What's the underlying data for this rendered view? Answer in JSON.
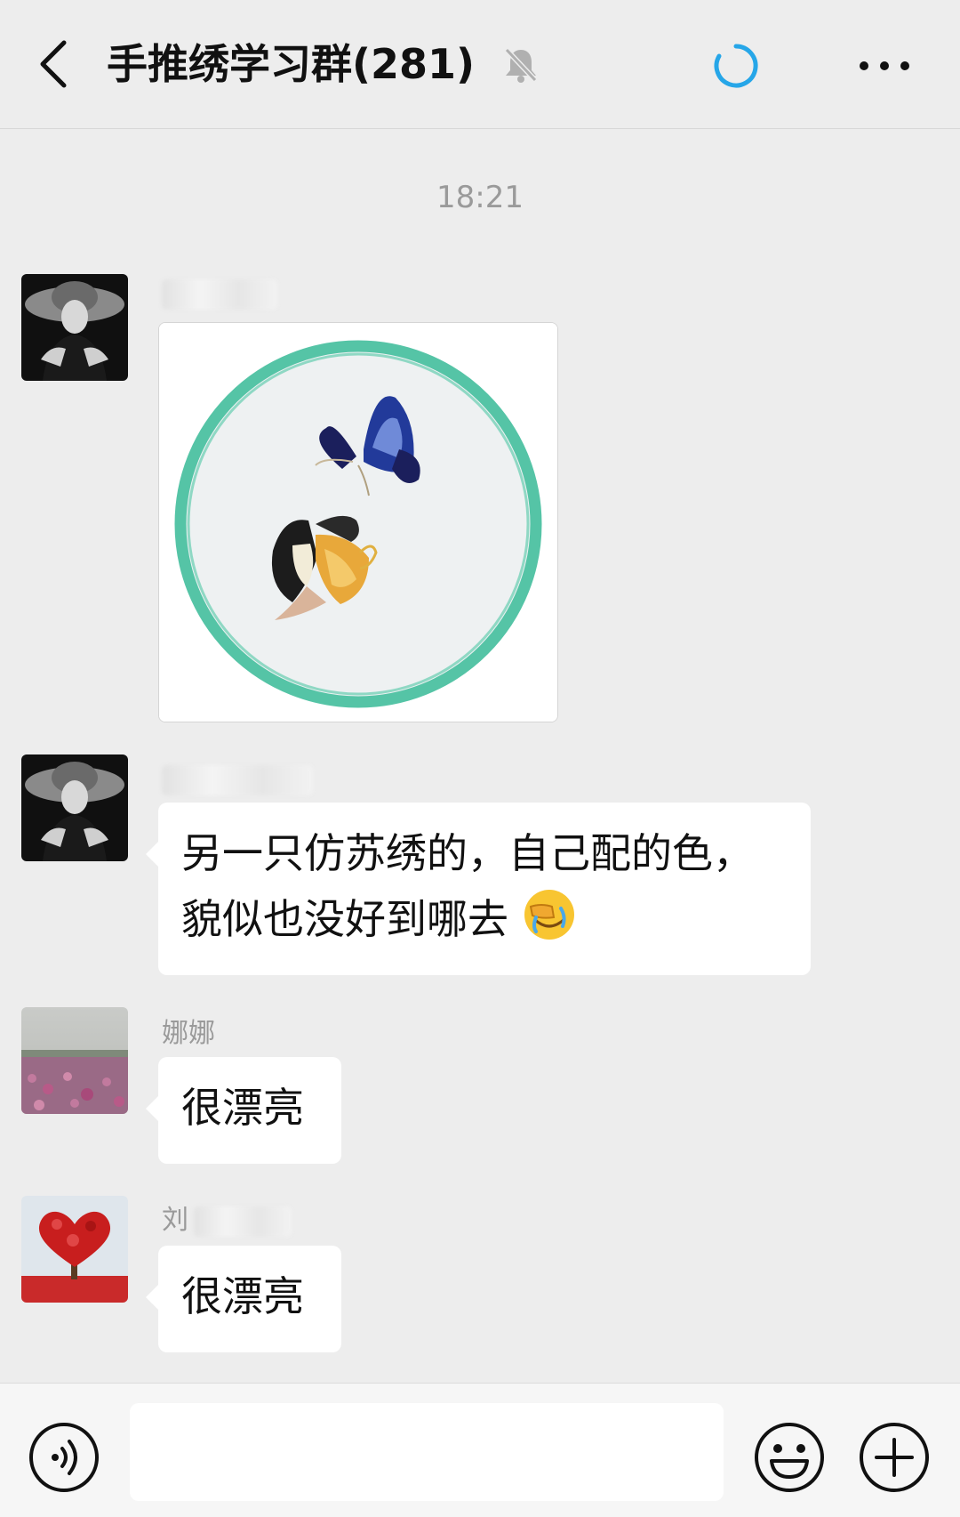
{
  "header": {
    "back_icon": "chevron-left-icon",
    "title": "手推绣学习群(281)",
    "muted_icon": "bell-slash-icon",
    "sync_icon": "loading-ring-icon",
    "more_icon": "more-dots-icon",
    "accent_color": "#26a6e8"
  },
  "chat": {
    "time": "18:21",
    "messages": [
      {
        "type": "image",
        "avatar": "woman-in-hat-avatar",
        "image": "embroidery-hoop-two-butterflies"
      },
      {
        "type": "text",
        "avatar": "woman-in-hat-avatar",
        "text_line1": "另一只仿苏绣的，自己配的色，",
        "text_line2": "貌似也没好到哪去",
        "emoji": "face-palm-crying-emoji"
      },
      {
        "type": "text",
        "avatar": "flower-field-avatar",
        "sender": "娜娜",
        "text": "很漂亮"
      },
      {
        "type": "text",
        "avatar": "red-heart-tree-avatar",
        "sender_partial": "刘",
        "text": "很漂亮"
      }
    ]
  },
  "input_bar": {
    "voice_icon": "voice-input-icon",
    "emoji_icon": "smile-face-icon",
    "plus_icon": "plus-circle-icon",
    "input_value": ""
  }
}
